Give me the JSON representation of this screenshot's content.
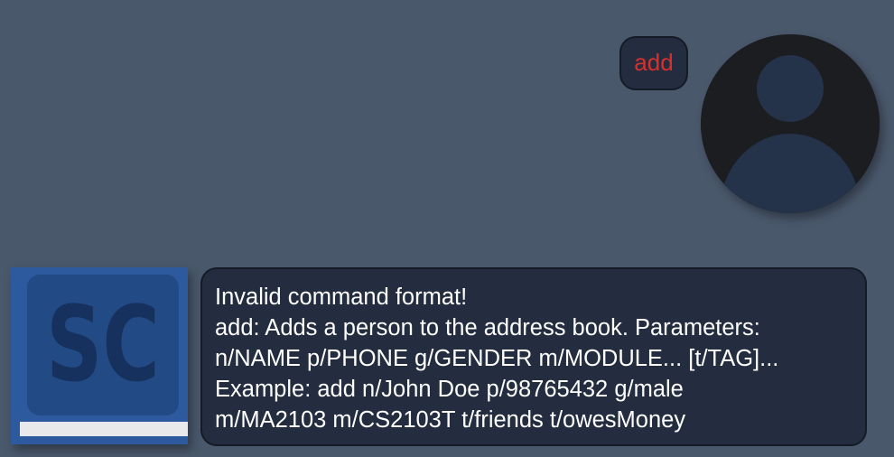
{
  "user_message": {
    "text": "add"
  },
  "bot_message": {
    "lines": [
      "Invalid command format!",
      "add: Adds a person to the address book. Parameters:",
      "n/NAME p/PHONE g/GENDER m/MODULE... [t/TAG]...",
      "Example: add n/John Doe p/98765432 g/male",
      "m/MA2103 m/CS2103T t/friends t/owesMoney"
    ]
  },
  "bot_logo": {
    "text": "SC"
  },
  "icons": {
    "user_avatar": "user-silhouette-icon",
    "bot_avatar": "book-logo-icon"
  },
  "colors": {
    "background": "#4a586c",
    "bubble": "#232d3f",
    "user_text": "#d7312d",
    "bot_text": "#ffffff",
    "logo_blue": "#2d5a9f"
  }
}
